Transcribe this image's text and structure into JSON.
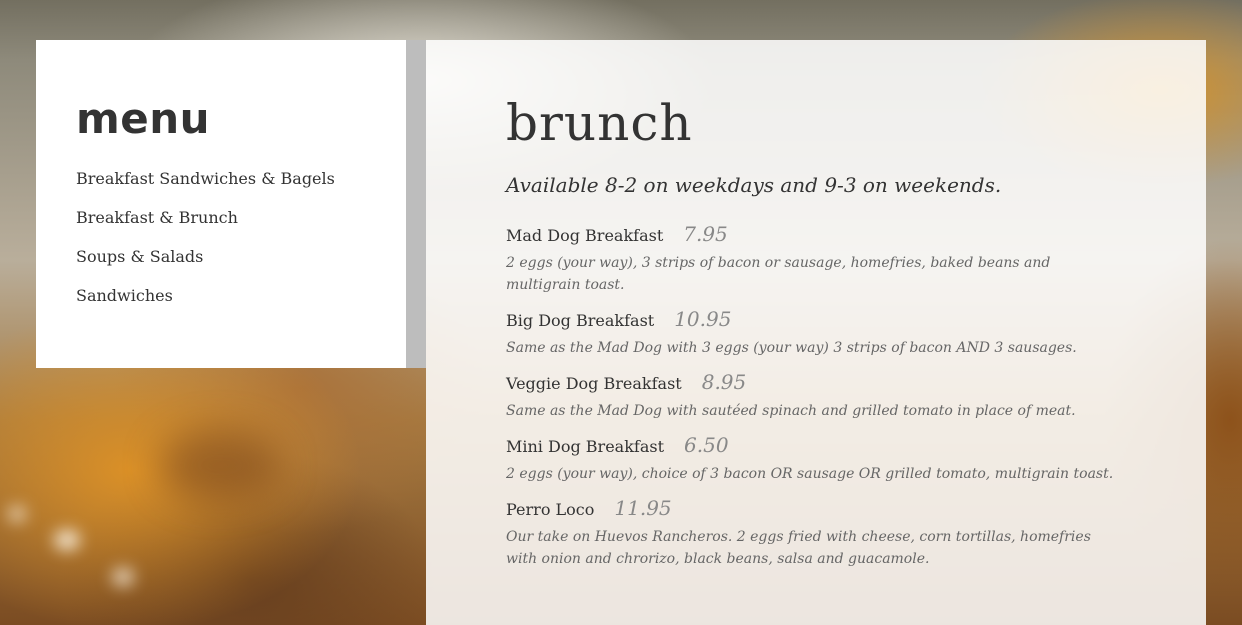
{
  "menu": {
    "title": "menu",
    "items": [
      {
        "label": "Breakfast Sandwiches & Bagels"
      },
      {
        "label": "Breakfast & Brunch"
      },
      {
        "label": "Soups & Salads"
      },
      {
        "label": "Sandwiches"
      }
    ]
  },
  "section": {
    "title": "brunch",
    "subtitle": "Available 8-2 on weekdays and 9-3 on weekends.",
    "items": [
      {
        "name": "Mad Dog Breakfast",
        "price": "7.95",
        "description": "2 eggs (your way), 3 strips of bacon or sausage, homefries, baked beans and multigrain toast."
      },
      {
        "name": "Big Dog Breakfast",
        "price": "10.95",
        "description": "Same as the Mad Dog with 3 eggs (your way) 3 strips of bacon AND 3 sausages."
      },
      {
        "name": "Veggie Dog Breakfast",
        "price": "8.95",
        "description": "Same as the Mad Dog with sautéed spinach and grilled tomato in place of meat."
      },
      {
        "name": "Mini Dog Breakfast",
        "price": "6.50",
        "description": "2 eggs (your way), choice of 3 bacon OR sausage OR grilled tomato, multigrain toast."
      },
      {
        "name": "Perro Loco",
        "price": "11.95",
        "description": "Our take on Huevos Rancheros. 2 eggs fried with cheese, corn tortillas, homefries with onion and chrorizo, black beans, salsa and guacamole."
      }
    ]
  }
}
